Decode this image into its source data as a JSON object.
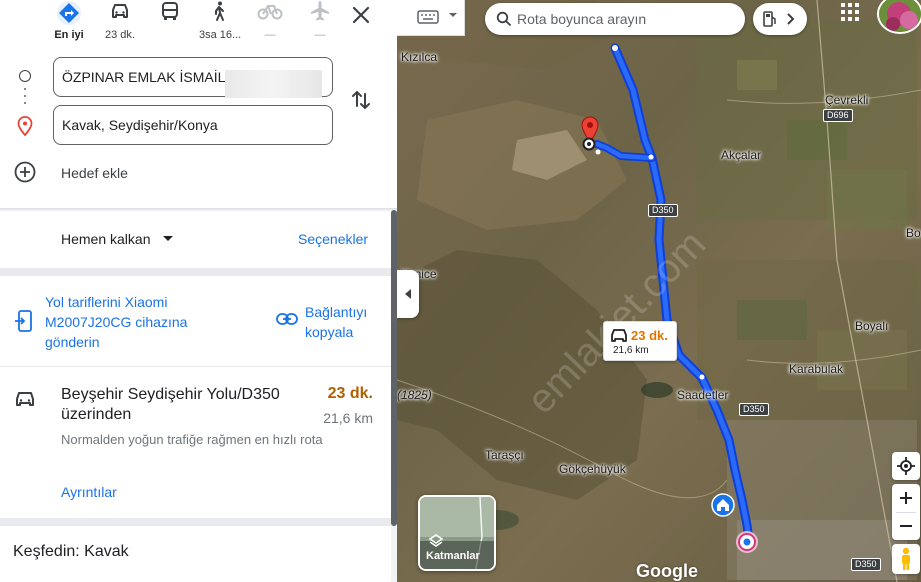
{
  "travel_modes": [
    {
      "name": "best",
      "label": "En iyi"
    },
    {
      "name": "driving",
      "label": "23 dk."
    },
    {
      "name": "transit",
      "label": ""
    },
    {
      "name": "walking",
      "label": "3sa 16..."
    },
    {
      "name": "cycling",
      "label": "—"
    },
    {
      "name": "flights",
      "label": "—"
    }
  ],
  "directions": {
    "origin": "ÖZPINAR EMLAK İSMAİL",
    "destination": "Kavak, Seydişehir/Konya",
    "add_destination": "Hedef ekle"
  },
  "options": {
    "leave_now": "Hemen kalkan",
    "options_link": "Seçenekler"
  },
  "send": {
    "send_text": "Yol tariflerini Xiaomi M2007J20CG cihazına gönderin",
    "copy_text": "Bağlantıyı kopyala"
  },
  "route": {
    "name": "Beyşehir Seydişehir Yolu/D350 üzerinden",
    "time": "23 dk.",
    "distance": "21,6 km",
    "note": "Normalden yoğun trafiğe rağmen en hızlı rota",
    "details": "Ayrıntılar"
  },
  "explore": "Keşfedin: Kavak",
  "map": {
    "search_placeholder": "Rota boyunca arayın",
    "callout_time": "23 dk.",
    "callout_distance": "21,6 km",
    "layers_label": "Katmanlar",
    "google": "Google",
    "watermark": "emlakjet.com",
    "places": [
      "Kızılca",
      "Çevrekli",
      "Akçalar",
      "Bo",
      "Yenice",
      "Boyalı",
      "Karabulak",
      "Saadetler",
      "(1825)",
      "Taraşçı",
      "Gökçehüyük"
    ],
    "roads": [
      "D696",
      "D350",
      "D350",
      "D350"
    ]
  },
  "colors": {
    "route_blue": "#1a45f0",
    "link_blue": "#1a73e8",
    "time_orange": "#b06000",
    "destination_pin": "#ea4335"
  }
}
